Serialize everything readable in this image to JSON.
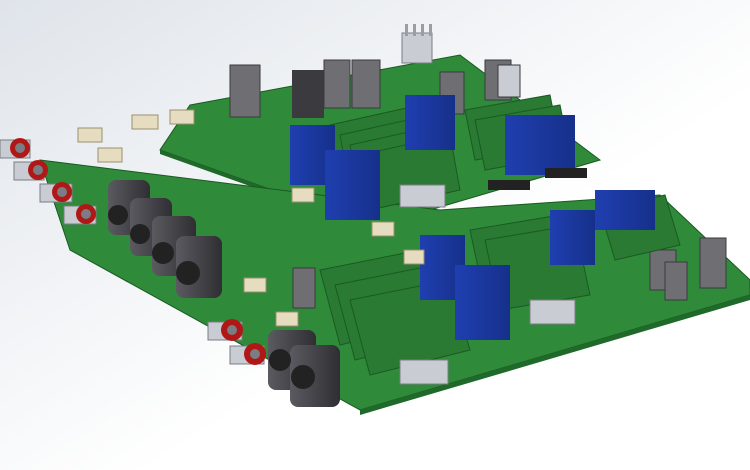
{
  "scene": {
    "subject": "pcb-assembly-render",
    "colors": {
      "background_top": "#dfe4ea",
      "background_bottom": "#ffffff",
      "pcb_green": "#2f8a3a",
      "pcb_green_dark": "#1f6a2a",
      "pcb_edge": "#1a5a22",
      "capacitor_blue": "#1f3fb0",
      "capacitor_blue_dark": "#16308a",
      "connector_grey": "#6e6e73",
      "connector_dark": "#3a3a3f",
      "header_beige": "#e6dcc0",
      "rca_red": "#b01818",
      "metal": "#c9ccd2"
    }
  }
}
